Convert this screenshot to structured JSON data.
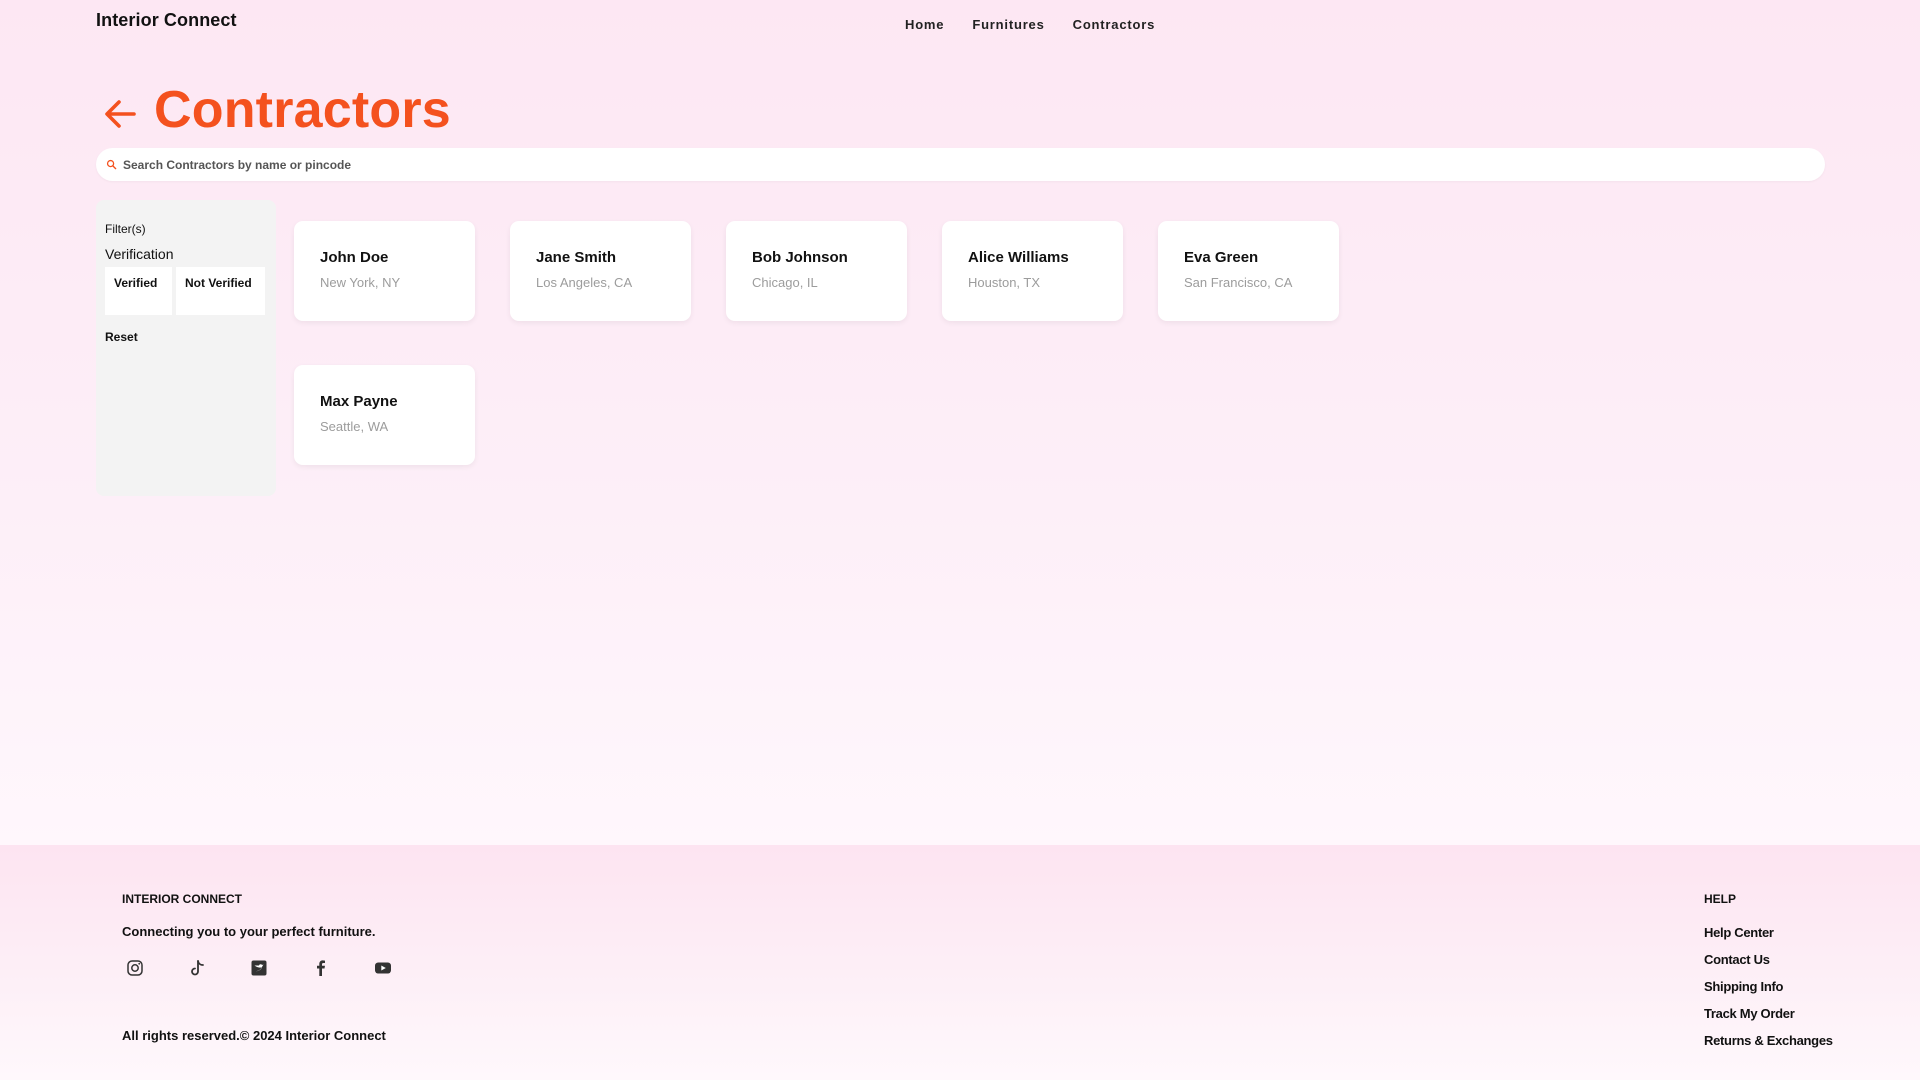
{
  "header": {
    "brand": "Interior Connect",
    "nav": [
      {
        "label": "Home"
      },
      {
        "label": "Furnitures"
      },
      {
        "label": "Contractors"
      }
    ]
  },
  "page": {
    "title": "Contractors",
    "back_icon": "arrow-left-icon",
    "accent_color": "#f4511e"
  },
  "search": {
    "placeholder": "Search Contractors by name or pincode",
    "value": "",
    "icon": "search-icon"
  },
  "filters": {
    "heading": "Filter(s)",
    "verification_label": "Verification",
    "options": [
      "Verified",
      "Not Verified"
    ],
    "reset_label": "Reset"
  },
  "contractors": [
    {
      "name": "John Doe",
      "location": "New York, NY"
    },
    {
      "name": "Jane Smith",
      "location": "Los Angeles, CA"
    },
    {
      "name": "Bob Johnson",
      "location": "Chicago, IL"
    },
    {
      "name": "Alice Williams",
      "location": "Houston, TX"
    },
    {
      "name": "Eva Green",
      "location": "San Francisco, CA"
    },
    {
      "name": "Max Payne",
      "location": "Seattle, WA"
    }
  ],
  "footer": {
    "brand": "INTERIOR CONNECT",
    "tagline": "Connecting you to your perfect furniture.",
    "socials": [
      "instagram-icon",
      "tiktok-icon",
      "twitter-icon",
      "facebook-icon",
      "youtube-icon"
    ],
    "copyright": "All rights reserved.© 2024 Interior Connect",
    "help_title": "HELP",
    "help_links": [
      "Help Center",
      "Contact Us",
      "Shipping Info",
      "Track My Order",
      "Returns & Exchanges"
    ]
  }
}
